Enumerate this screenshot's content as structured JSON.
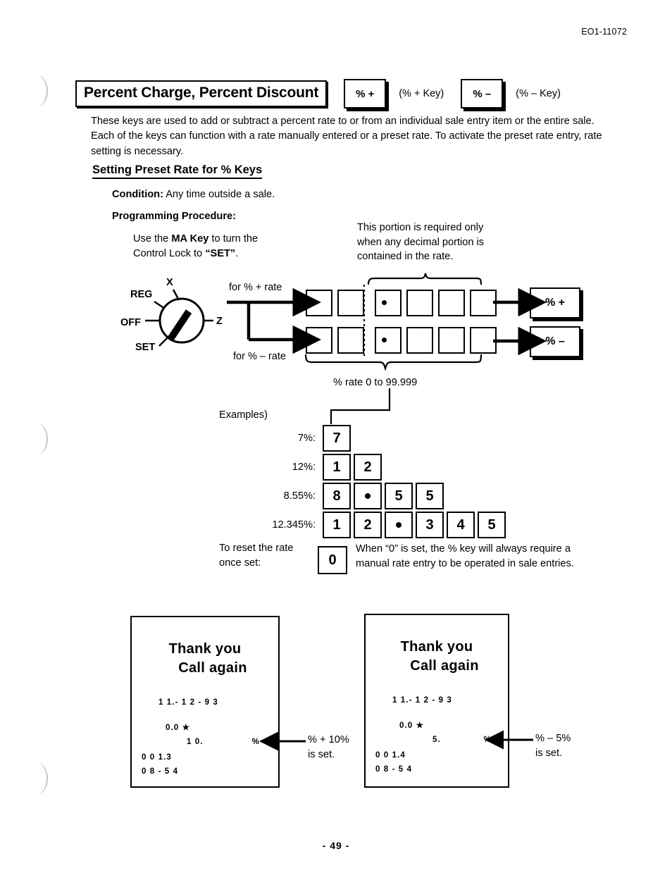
{
  "doc": {
    "code": "EO1-11072",
    "page_number": "- 49 -"
  },
  "header": {
    "title": "Percent Charge, Percent Discount",
    "keys": [
      {
        "label": "% +",
        "caption": "(% + Key)"
      },
      {
        "label": "% –",
        "caption": "(% – Key)"
      }
    ]
  },
  "intro": "These keys are used to add or subtract a percent rate to or from an individual sale entry item or the entire sale.  Each of the keys can function with a rate manually entered or a preset rate.  To activate the preset rate entry, rate setting is necessary.",
  "section": {
    "heading": "Setting Preset Rate for % Keys",
    "condition_label": "Condition:",
    "condition_value": " Any time outside a sale.",
    "procedure_label": "Programming Procedure:"
  },
  "procedure": {
    "instruction_line1_a": "Use the ",
    "instruction_line1_b": "MA Key",
    "instruction_line1_c": " to turn the",
    "instruction_line2_a": "Control Lock to ",
    "instruction_line2_b": "“SET”",
    "instruction_line2_c": "."
  },
  "decimal_note": "This portion is required only when any decimal portion is contained in the rate.",
  "dial": {
    "labels": {
      "x": "X",
      "reg": "REG",
      "off": "OFF",
      "set": "SET",
      "z": "Z"
    },
    "pointing_at": "SET"
  },
  "flow": {
    "branch_plus": "for % + rate",
    "branch_minus": "for % – rate",
    "result_plus": "% +",
    "result_minus": "% –",
    "rate_caption": "% rate 0 to 99.999",
    "entry_row_boxes": 6,
    "decimal_divider_after_box": 2,
    "dot_box_index": 3
  },
  "examples": {
    "label": "Examples)",
    "rows": [
      {
        "rate": "7%:",
        "keys": [
          "7"
        ]
      },
      {
        "rate": "12%:",
        "keys": [
          "1",
          "2"
        ]
      },
      {
        "rate": "8.55%:",
        "keys": [
          "8",
          ".",
          "5",
          "5"
        ]
      },
      {
        "rate": "12.345%:",
        "keys": [
          "1",
          "2",
          ".",
          "3",
          "4",
          "5"
        ]
      }
    ]
  },
  "reset": {
    "label_line1": "To reset the rate",
    "label_line2": "once set:",
    "key": "0",
    "note": "When “0” is set, the % key will always require a manual rate entry to be operated in sale entries."
  },
  "receipts": [
    {
      "id": "percent-plus",
      "thanks_line1": "Thank you",
      "thanks_line2": "Call  again",
      "date": "1 1.- 1 2 - 9 3",
      "amount_star": "0.0 ★",
      "amount": "1 0.",
      "pct_symbol": "% +",
      "footer1": "0 0 1.3",
      "footer2": "0 8 - 5 4",
      "annotation_line1": "% + 10%",
      "annotation_line2": "is set."
    },
    {
      "id": "percent-minus",
      "thanks_line1": "Thank you",
      "thanks_line2": "Call  again",
      "date": "1 1.- 1 2 - 9 3",
      "amount_star": "0.0 ★",
      "amount": "5.",
      "pct_symbol": "% -",
      "footer1": "0 0 1.4",
      "footer2": "0 8 - 5 4",
      "annotation_line1": "% –  5%",
      "annotation_line2": "is set."
    }
  ]
}
